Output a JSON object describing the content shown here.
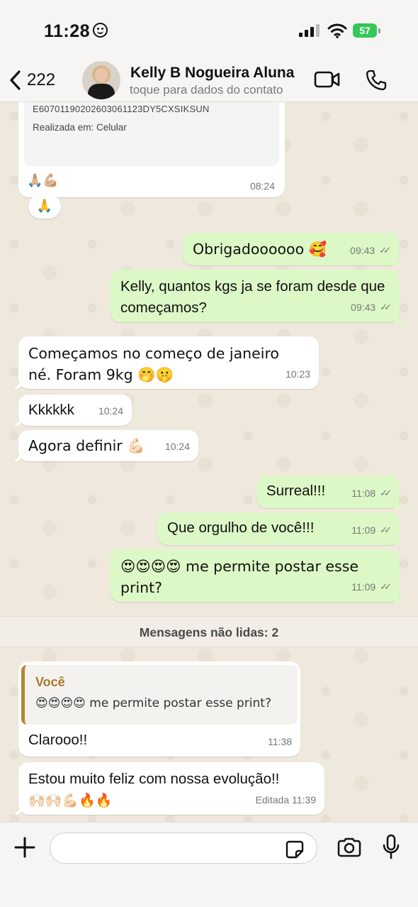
{
  "status_bar": {
    "time": "11:28",
    "battery": "57"
  },
  "header": {
    "back_count": "222",
    "contact_name": "Kelly B Nogueira Aluna",
    "contact_subtitle": "toque para dados do contato"
  },
  "receipt": {
    "code": "E60701190202603061123DY5CXSIKSUN",
    "made_in": "Realizada em:  Celular",
    "emoji": "🙏🏼💪🏼",
    "time": "08:24",
    "reaction": "🙏"
  },
  "messages": [
    {
      "text": "Obrigadoooooo 🥰",
      "time": "09:43",
      "dir": "out"
    },
    {
      "text": "Kelly, quantos kgs ja se foram desde que começamos?",
      "time": "09:43",
      "dir": "out"
    },
    {
      "text": "Começamos no começo de janeiro né. Foram 9kg 🤭🤫",
      "time": "10:23",
      "dir": "in"
    },
    {
      "text": "Kkkkkk",
      "time": "10:24",
      "dir": "in"
    },
    {
      "text": "Agora definir 💪🏻",
      "time": "10:24",
      "dir": "in"
    },
    {
      "text": "Surreal!!!",
      "time": "11:08",
      "dir": "out"
    },
    {
      "text": "Que orgulho de você!!!",
      "time": "11:09",
      "dir": "out"
    },
    {
      "text": "😍😍😍😍 me permite postar esse print?",
      "time": "11:09",
      "dir": "out"
    }
  ],
  "unread_divider": "Mensagens não lidas: 2",
  "reply": {
    "quote_author": "Você",
    "quote_text": "😍😍😍😍 me permite postar esse print?",
    "text": "Clarooo!!",
    "time": "11:38"
  },
  "last_message": {
    "text": "Estou muito feliz com nossa evolução!!",
    "emoji": "🙌🏻🙌🏻💪🏻🔥🔥",
    "time": "Editada 11:39"
  },
  "composer": {
    "placeholder": ""
  }
}
